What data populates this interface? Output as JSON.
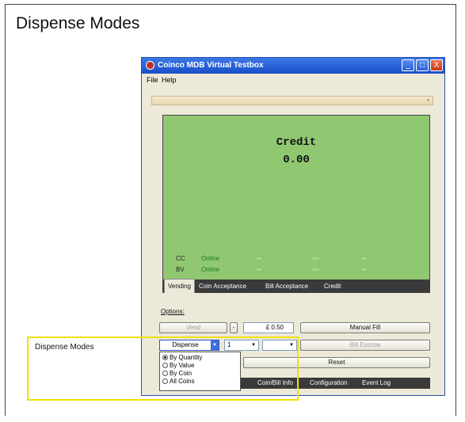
{
  "slide": {
    "title": "Dispense Modes"
  },
  "window": {
    "title": "Coinco MDB Virtual Testbox",
    "menu": [
      "File",
      "Help"
    ],
    "collapse_glyph": "▫",
    "controls": {
      "minimize": "_",
      "maximize": "□",
      "close": "X"
    }
  },
  "display": {
    "label": "Credit",
    "value": "0.00",
    "rows": [
      {
        "code": "CC",
        "status": "Online"
      },
      {
        "code": "BV",
        "status": "Online"
      }
    ]
  },
  "tabs": [
    "Vending",
    "Coin Acceptance",
    "Bill Acceptance",
    "Credit"
  ],
  "options": {
    "label": "Options:",
    "vend_button": "Vend",
    "minus_button": "-",
    "price_value": "£ 0.50",
    "manual_fill_button": "Manual Fill",
    "dispense_select": "Dispense",
    "quantity_select": "1",
    "blank_select": "",
    "bill_escrow_button": "Bill Escrow",
    "reset_button": "Reset"
  },
  "dispense_popup": {
    "options": [
      "By Quantity",
      "By Value",
      "By Coin",
      "All Coins"
    ],
    "selected": "By Quantity"
  },
  "bottom_tabs": [
    "Coin/Bill Info",
    "Configuration",
    "Event Log"
  ],
  "callout": {
    "label": "Dispense Modes",
    "color": "#f0e000"
  },
  "colors": {
    "display_green": "#8fc870",
    "online_green": "#1a7a1a",
    "titlebar_blue": "#1b4fc8"
  }
}
